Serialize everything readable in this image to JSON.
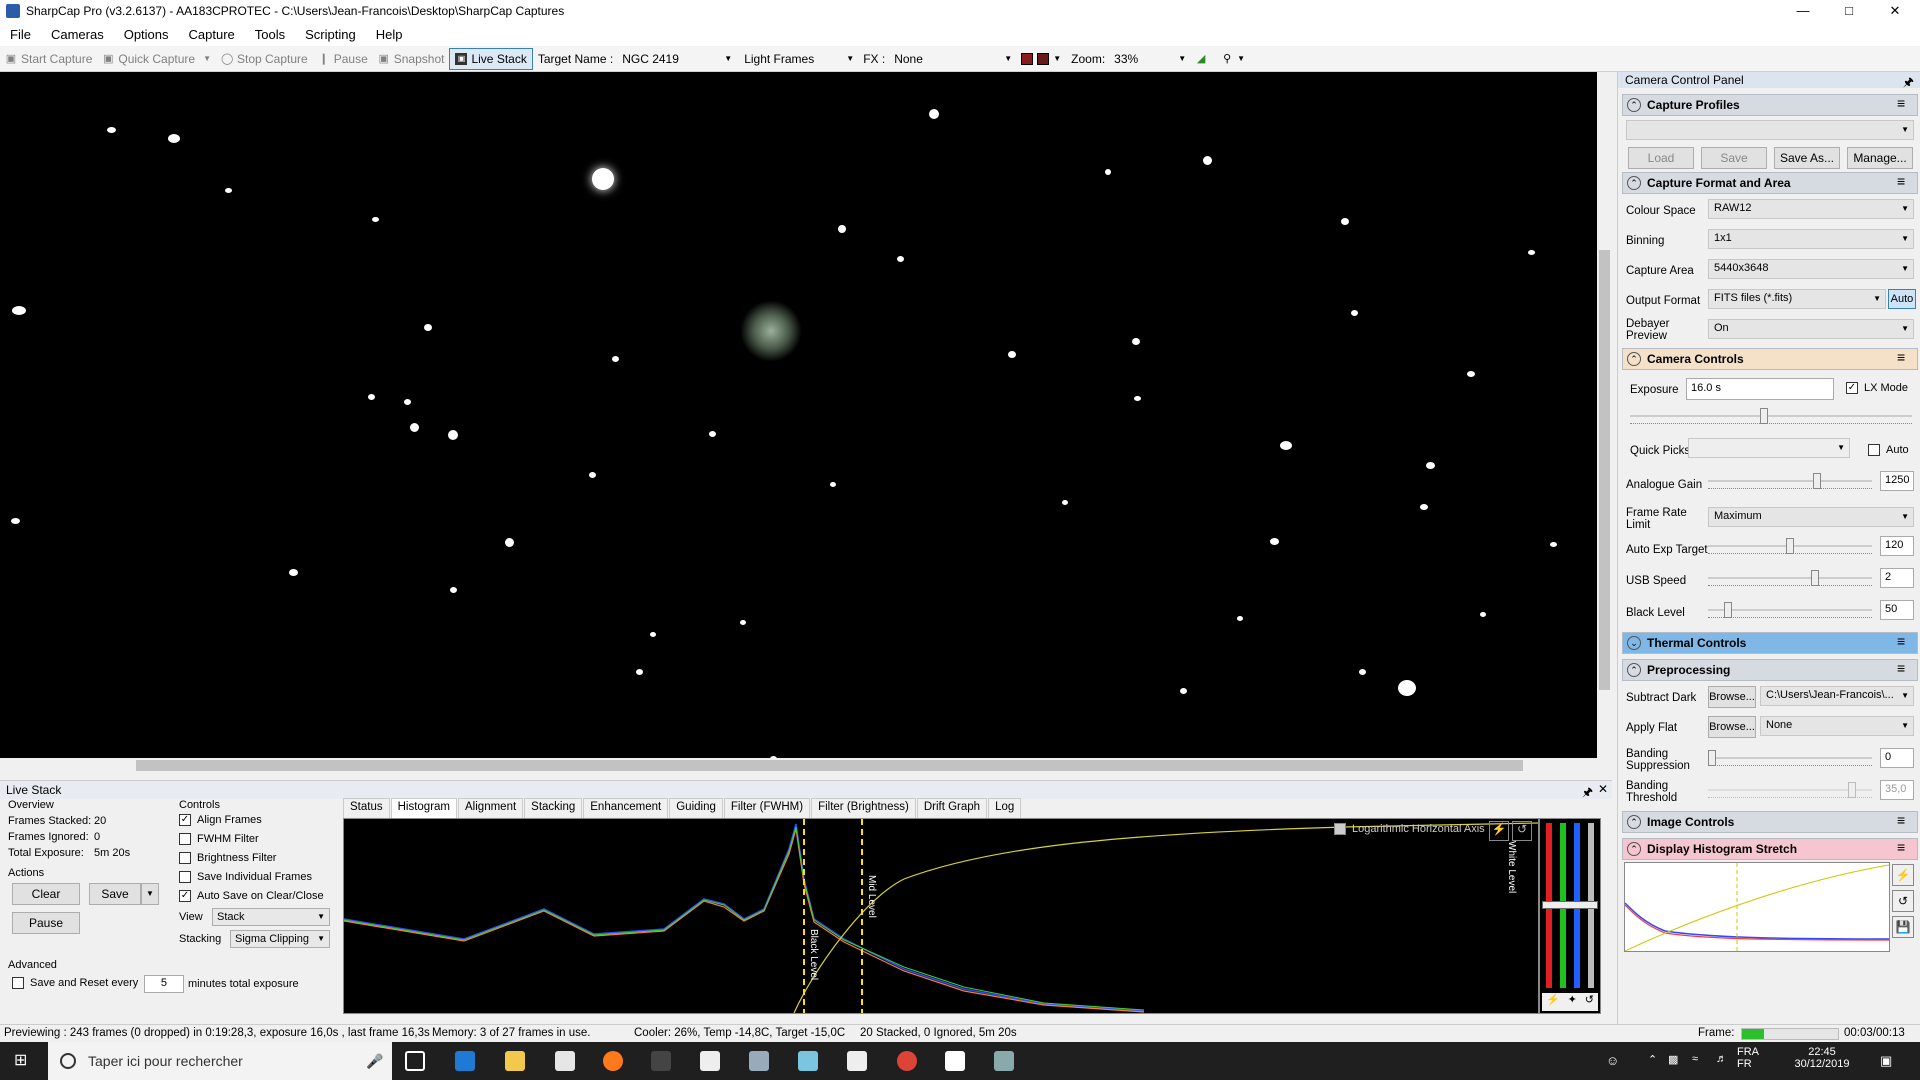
{
  "titlebar": {
    "title": "SharpCap Pro (v3.2.6137) - AA183CPROTEC - C:\\Users\\Jean-Francois\\Desktop\\SharpCap Captures",
    "min": "—",
    "max": "□",
    "close": "✕"
  },
  "menu": [
    "File",
    "Cameras",
    "Options",
    "Capture",
    "Tools",
    "Scripting",
    "Help"
  ],
  "toolbar": {
    "start_capture": "Start Capture",
    "quick_capture": "Quick Capture",
    "stop_capture": "Stop Capture",
    "pause": "Pause",
    "snapshot": "Snapshot",
    "live_stack": "Live Stack",
    "target_label": "Target Name :",
    "target_value": "NGC 2419",
    "frame_type": "Light Frames",
    "fx_label": "FX :",
    "fx_value": "None",
    "zoom_label": "Zoom:",
    "zoom_value": "33%"
  },
  "livestack": {
    "title": "Live Stack",
    "overview_label": "Overview",
    "frames_stacked_label": "Frames Stacked:",
    "frames_stacked": "20",
    "frames_ignored_label": "Frames Ignored:",
    "frames_ignored": "0",
    "total_exposure_label": "Total Exposure:",
    "total_exposure": "5m 20s",
    "actions_label": "Actions",
    "clear": "Clear",
    "save": "Save",
    "pause": "Pause",
    "advanced_label": "Advanced",
    "save_reset_label": "Save and Reset every",
    "save_reset_value": "5",
    "save_reset_suffix": "minutes total exposure",
    "controls_label": "Controls",
    "align_frames": "Align Frames",
    "fwhm_filter": "FWHM Filter",
    "brightness_filter": "Brightness Filter",
    "save_individual": "Save Individual Frames",
    "auto_save": "Auto Save on Clear/Close",
    "view_label": "View",
    "view_value": "Stack",
    "stacking_label": "Stacking",
    "stacking_value": "Sigma Clipping",
    "tabs": [
      "Status",
      "Histogram",
      "Alignment",
      "Stacking",
      "Enhancement",
      "Guiding",
      "Filter (FWHM)",
      "Filter (Brightness)",
      "Drift Graph",
      "Log"
    ],
    "selected_tab": "Histogram",
    "log_axis_label": "Logarithmic Horizontal Axis",
    "black_level_label": "Black Level",
    "mid_level_label": "Mid Level",
    "white_level_label": "White Level"
  },
  "status": {
    "preview": "Previewing : 243 frames (0 dropped) in 0:19:28,3, exposure 16,0s , last frame 16,3s",
    "memory": "Memory: 3 of 27 frames in use.",
    "cooler": "Cooler: 26%, Temp -14,8C, Target -15,0C",
    "stacked": "20 Stacked, 0 Ignored, 5m 20s",
    "frame_label": "Frame:",
    "frame_time": "00:03/00:13"
  },
  "ccp": {
    "title": "Camera Control Panel",
    "capture_profiles": "Capture Profiles",
    "load": "Load",
    "save": "Save",
    "save_as": "Save As...",
    "manage": "Manage...",
    "capture_format": "Capture Format and Area",
    "colour_space_label": "Colour Space",
    "colour_space": "RAW12",
    "binning_label": "Binning",
    "binning": "1x1",
    "capture_area_label": "Capture Area",
    "capture_area": "5440x3648",
    "output_format_label": "Output Format",
    "output_format": "FITS files (*.fits)",
    "auto": "Auto",
    "debayer_label": "Debayer Preview",
    "debayer": "On",
    "camera_controls": "Camera Controls",
    "exposure_label": "Exposure",
    "exposure": "16.0 s",
    "lx_mode": "LX Mode",
    "quick_picks_label": "Quick Picks",
    "quick_auto": "Auto",
    "gain_label": "Analogue Gain",
    "gain": "1250",
    "gain_level": 0.67,
    "frame_rate_label": "Frame Rate Limit",
    "frame_rate": "Maximum",
    "auto_exp_label": "Auto Exp Target",
    "auto_exp": "120",
    "auto_exp_level": 0.5,
    "usb_label": "USB Speed",
    "usb": "2",
    "usb_level": 0.66,
    "black_label": "Black Level",
    "black": "50",
    "black_level": 0.1,
    "thermal": "Thermal Controls",
    "preprocessing": "Preprocessing",
    "subtract_dark_label": "Subtract Dark",
    "browse": "Browse...",
    "subtract_dark": "C:\\Users\\Jean-Francois\\...",
    "apply_flat_label": "Apply Flat",
    "apply_flat": "None",
    "banding_sup_label": "Banding Suppression",
    "banding_sup": "0",
    "banding_thr_label": "Banding Threshold",
    "banding_thr": "35,0",
    "image_controls": "Image Controls",
    "display_stretch": "Display Histogram Stretch"
  },
  "taskbar": {
    "search": "Taper ici pour rechercher",
    "lang1": "FRA",
    "lang2": "FR",
    "time": "22:45",
    "date": "30/12/2019"
  },
  "colors": {
    "accent": "#3c7fb1",
    "thermal": "#7fb7e6",
    "stretch": "#f5c6cf",
    "cam_controls": "#f5e1c8"
  }
}
